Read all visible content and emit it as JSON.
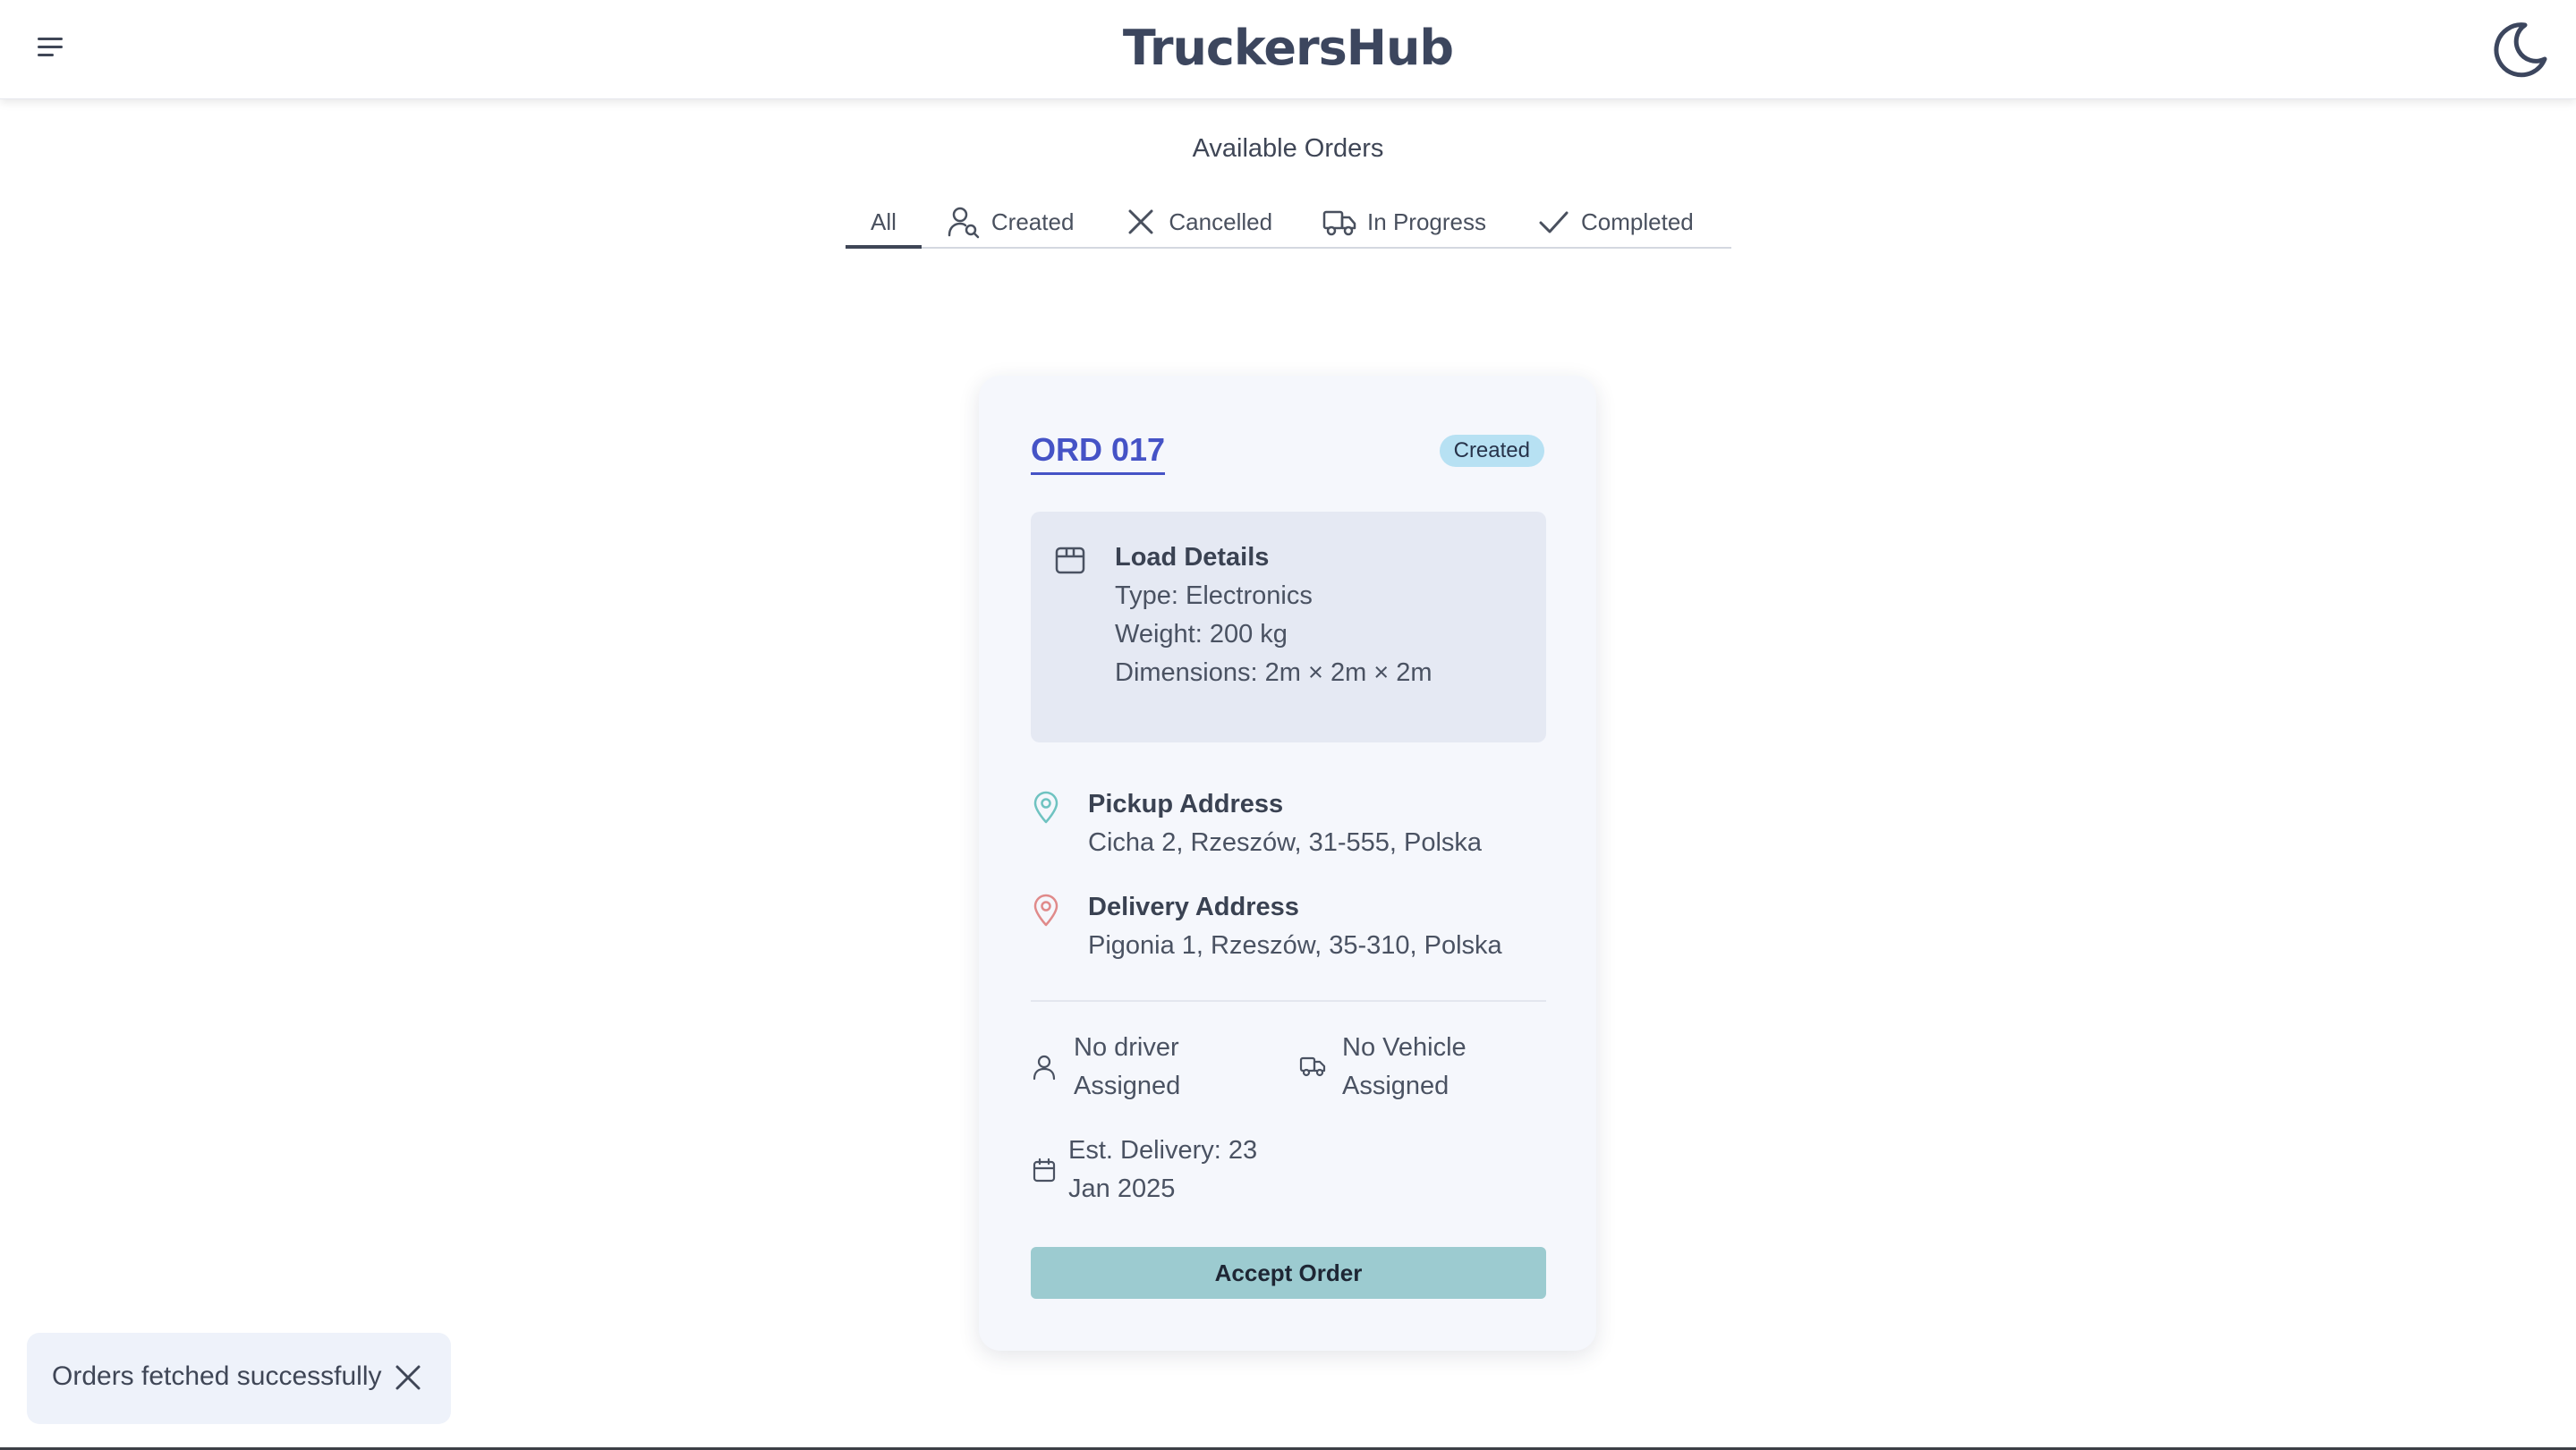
{
  "app": {
    "title": "TruckersHub"
  },
  "header": {
    "menu_icon": "hamburger-menu-icon",
    "theme_icon": "moon-icon"
  },
  "page": {
    "section_title": "Available Orders"
  },
  "tabs": [
    {
      "label": "All",
      "icon": "",
      "active": true
    },
    {
      "label": "Created",
      "icon": "user-search-icon",
      "active": false
    },
    {
      "label": "Cancelled",
      "icon": "x-icon",
      "active": false
    },
    {
      "label": "In Progress",
      "icon": "truck-icon",
      "active": false
    },
    {
      "label": "Completed",
      "icon": "check-icon",
      "active": false
    }
  ],
  "order": {
    "id": "ORD 017",
    "status": "Created",
    "load": {
      "heading": "Load Details",
      "type": "Type: Electronics",
      "weight": "Weight: 200 kg",
      "dimensions": "Dimensions: 2m × 2m × 2m"
    },
    "pickup": {
      "heading": "Pickup Address",
      "address": "Cicha 2, Rzeszów, 31-555, Polska"
    },
    "delivery": {
      "heading": "Delivery Address",
      "address": "Pigonia 1, Rzeszów, 35-310, Polska"
    },
    "driver": {
      "line1": "No driver",
      "line2": "Assigned"
    },
    "vehicle": {
      "line1": "No Vehicle",
      "line2": "Assigned"
    },
    "est_delivery": {
      "line1": "Est. Delivery: 23",
      "line2": "Jan 2025"
    },
    "accept_label": "Accept Order"
  },
  "toast": {
    "message": "Orders fetched successfully"
  },
  "colors": {
    "brand_text": "#3c465e",
    "order_link": "#4553c6",
    "badge_bg": "#b7e1f3",
    "accept_bg": "#9ccbd0",
    "pickup_pin": "#6fc3c1",
    "delivery_pin": "#e08a8a"
  }
}
